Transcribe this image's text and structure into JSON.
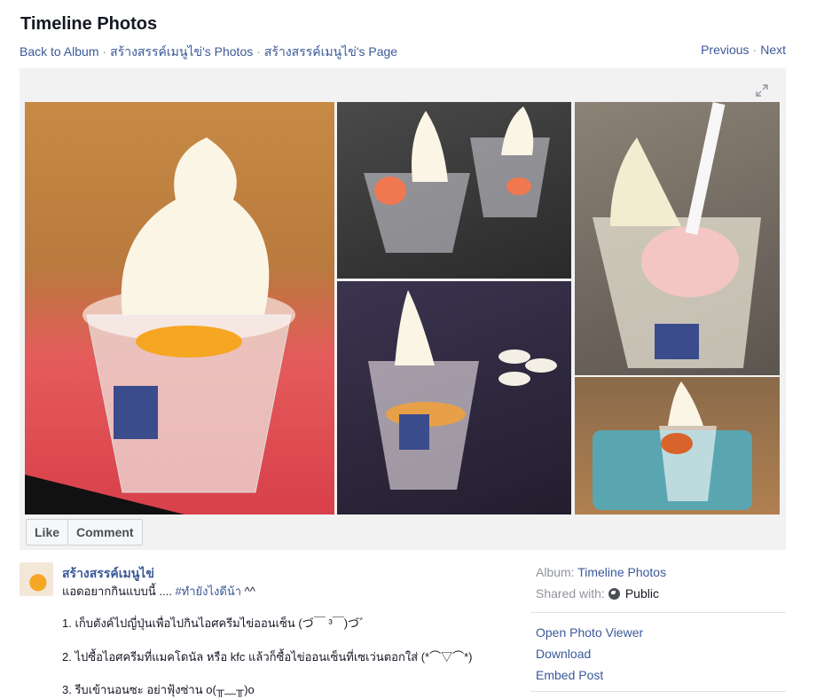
{
  "page": {
    "title": "Timeline Photos"
  },
  "breadcrumbs": [
    {
      "label": "Back to Album"
    },
    {
      "label": "สร้างสรรค์เมนูไข่'s Photos"
    },
    {
      "label": "สร้างสรรค์เมนูไข่'s Page"
    }
  ],
  "nav": {
    "previous": "Previous",
    "next": "Next"
  },
  "actions": {
    "like": "Like",
    "comment": "Comment"
  },
  "post": {
    "author": "สร้างสรรค์เมนูไข่",
    "intro": "แอดอยากกินแบบนี้ .... ",
    "hashtag": "#ทำยังไงดีน้า",
    "intro_tail": " ^^",
    "items": [
      "1. เก็บตังค์ไปญี่ปุ่นเพื่อไปกินไอศครีมไข่ออนเซ็น (づ￣ ³￣)づ゛",
      "2. ไปซื้อไอศครีมที่แมคโดนัล หรือ kfc แล้วก็ซื้อไข่ออนเซ็นที่เซเว่นตอกใส่ (*⌒▽⌒*)",
      "3. รีบเข้านอนซะ อย่าฟุ้งซ่าน o(╥﹏╥)o"
    ]
  },
  "meta": {
    "album_label": "Album:",
    "album_value": "Timeline Photos",
    "shared_label": "Shared with:",
    "shared_value": "Public",
    "shared_icon": "globe-icon"
  },
  "links": {
    "open_viewer": "Open Photo Viewer",
    "download": "Download",
    "embed": "Embed Post"
  },
  "colors": {
    "link": "#3b5998",
    "stage_bg": "#f2f2f2"
  }
}
